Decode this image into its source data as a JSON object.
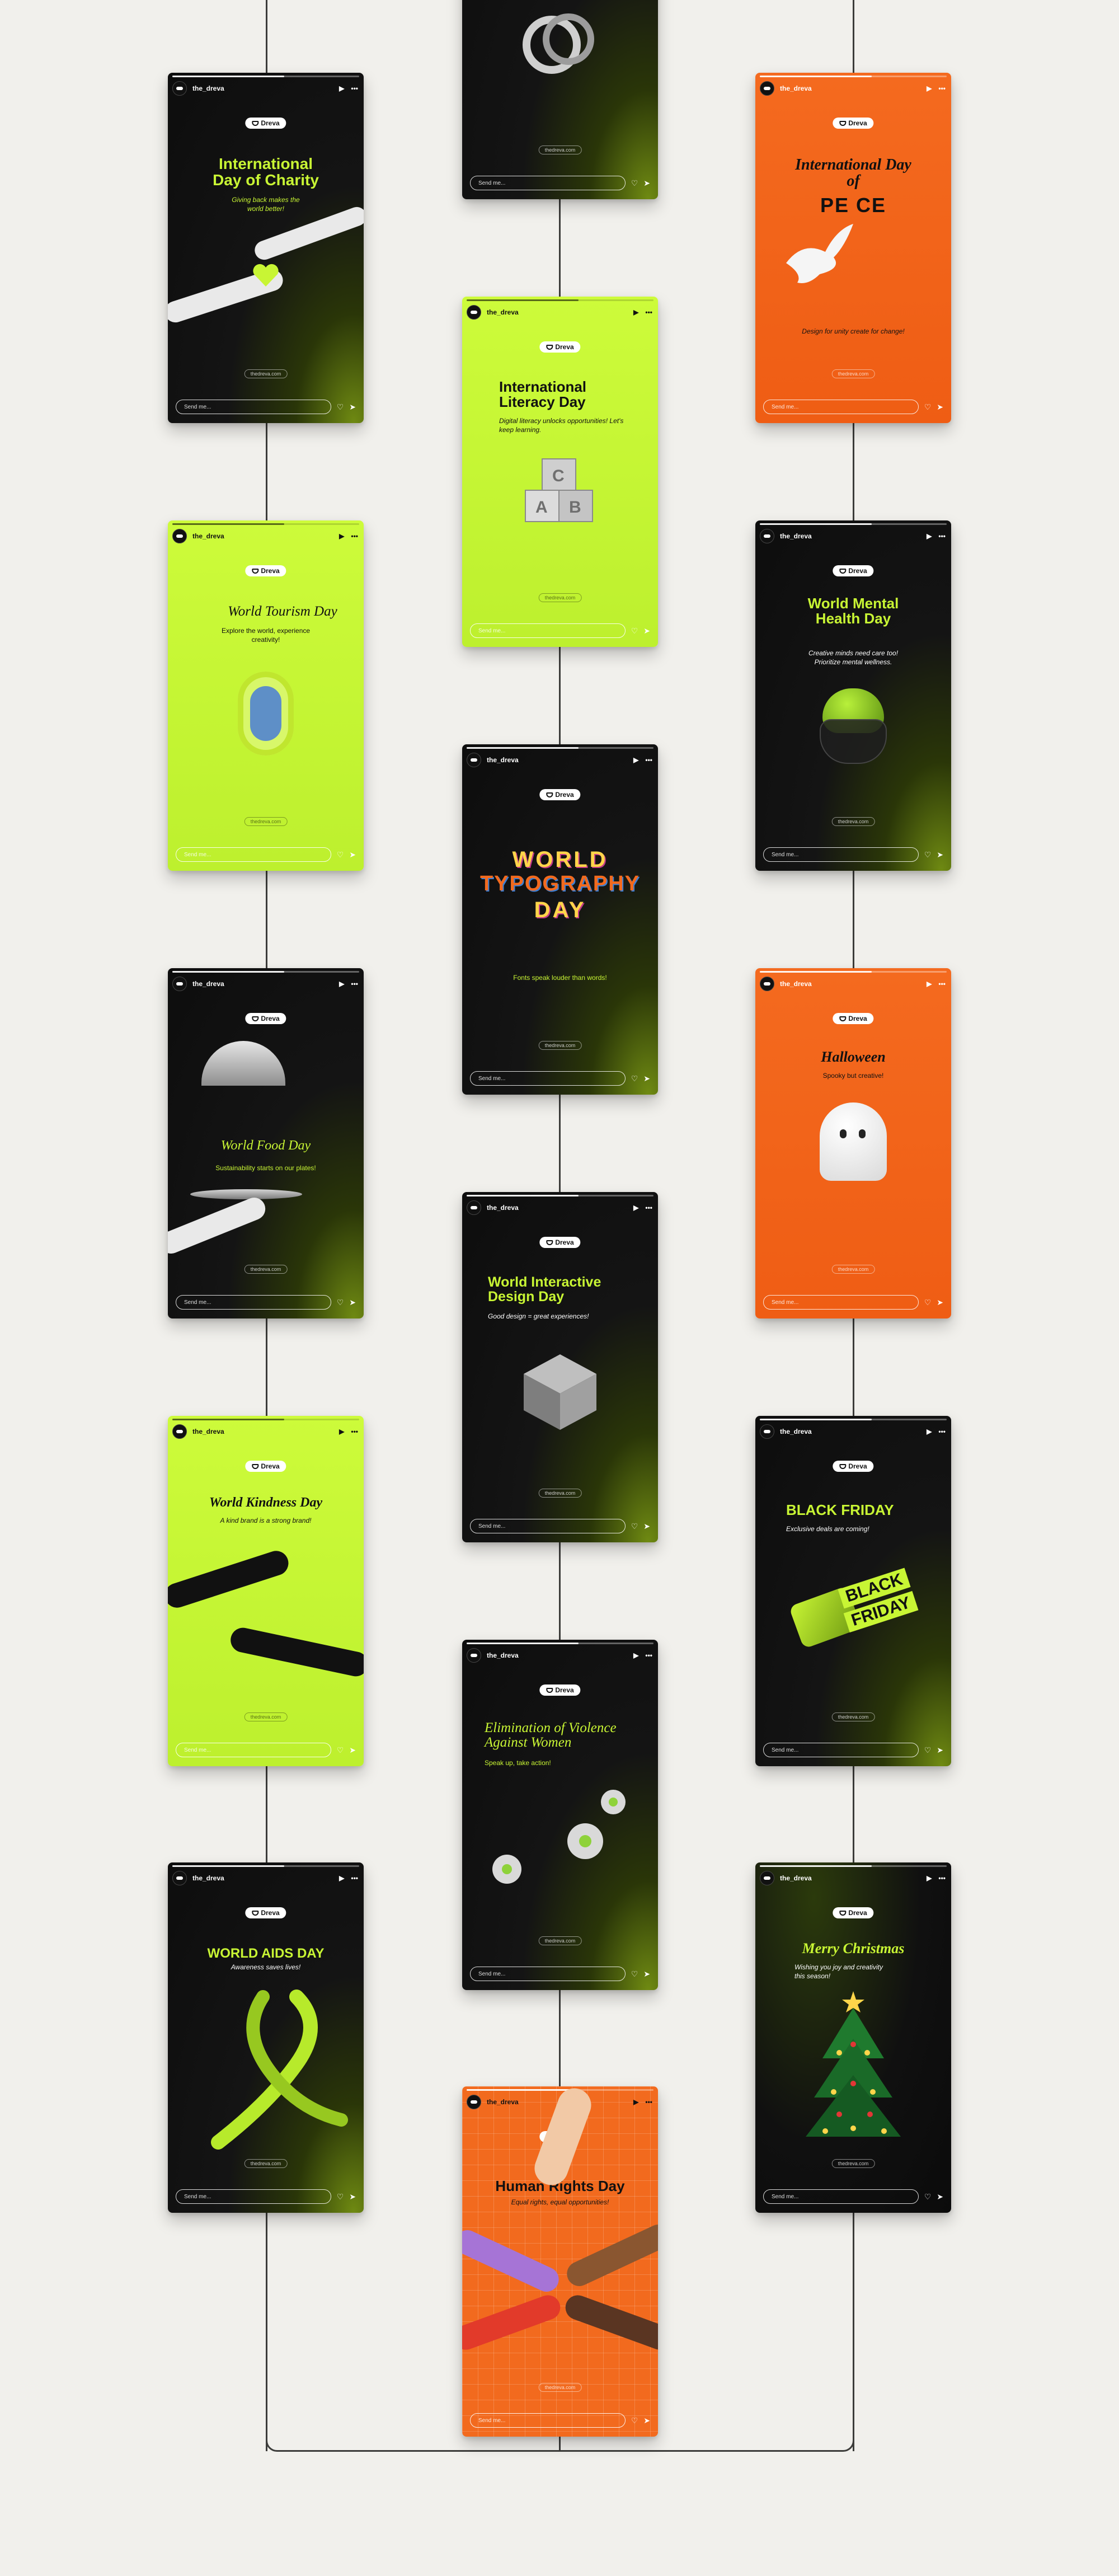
{
  "reply_placeholder": "Send me...",
  "brand_name": "Dreva",
  "username": "the_dreva",
  "url": "thedreva.com",
  "cards": {
    "charity": {
      "title": "International Day of Charity",
      "sub": "Giving back makes the world better!"
    },
    "literacy": {
      "title": "International Literacy Day",
      "sub": "Digital literacy unlocks opportunities! Let's keep learning."
    },
    "peace": {
      "title": "International Day of",
      "title2": "PE  CE",
      "sub": "Design for unity create for change!"
    },
    "tourism": {
      "title": "World Tourism Day",
      "sub": "Explore the world, experience creativity!"
    },
    "typography": {
      "line1": "WORLD",
      "line2": "TYPOGRAPHY",
      "line3": "DAY",
      "sub": "Fonts speak louder than words!"
    },
    "mental": {
      "title": "World Mental Health Day",
      "sub": "Creative minds need care too! Prioritize mental wellness."
    },
    "food": {
      "title": "World Food Day",
      "sub": "Sustainability starts on our plates!"
    },
    "interactive": {
      "title": "World Interactive Design Day",
      "sub": "Good design = great experiences!"
    },
    "halloween": {
      "title": "Halloween",
      "sub": "Spooky but creative!"
    },
    "kindness": {
      "title": "World Kindness Day",
      "sub": "A kind brand is a strong brand!"
    },
    "violence": {
      "title": "Elimination of Violence Against Women",
      "sub": "Speak up, take action!"
    },
    "blackfriday": {
      "title": "BLACK FRIDAY",
      "sub": "Exclusive deals are coming!",
      "badge1": "BLACK",
      "badge2": "FRIDAY"
    },
    "aids": {
      "title": "WORLD AIDS DAY",
      "sub": "Awareness saves lives!"
    },
    "rights": {
      "title": "Human Rights Day",
      "sub": "Equal rights, equal opportunities!"
    },
    "christmas": {
      "title": "Merry Christmas",
      "sub": "Wishing you joy and creativity this season!"
    }
  },
  "colors": {
    "lime": "#c8f534",
    "orange": "#f26a1e",
    "dark": "#111111",
    "background": "#f1f0ec"
  }
}
